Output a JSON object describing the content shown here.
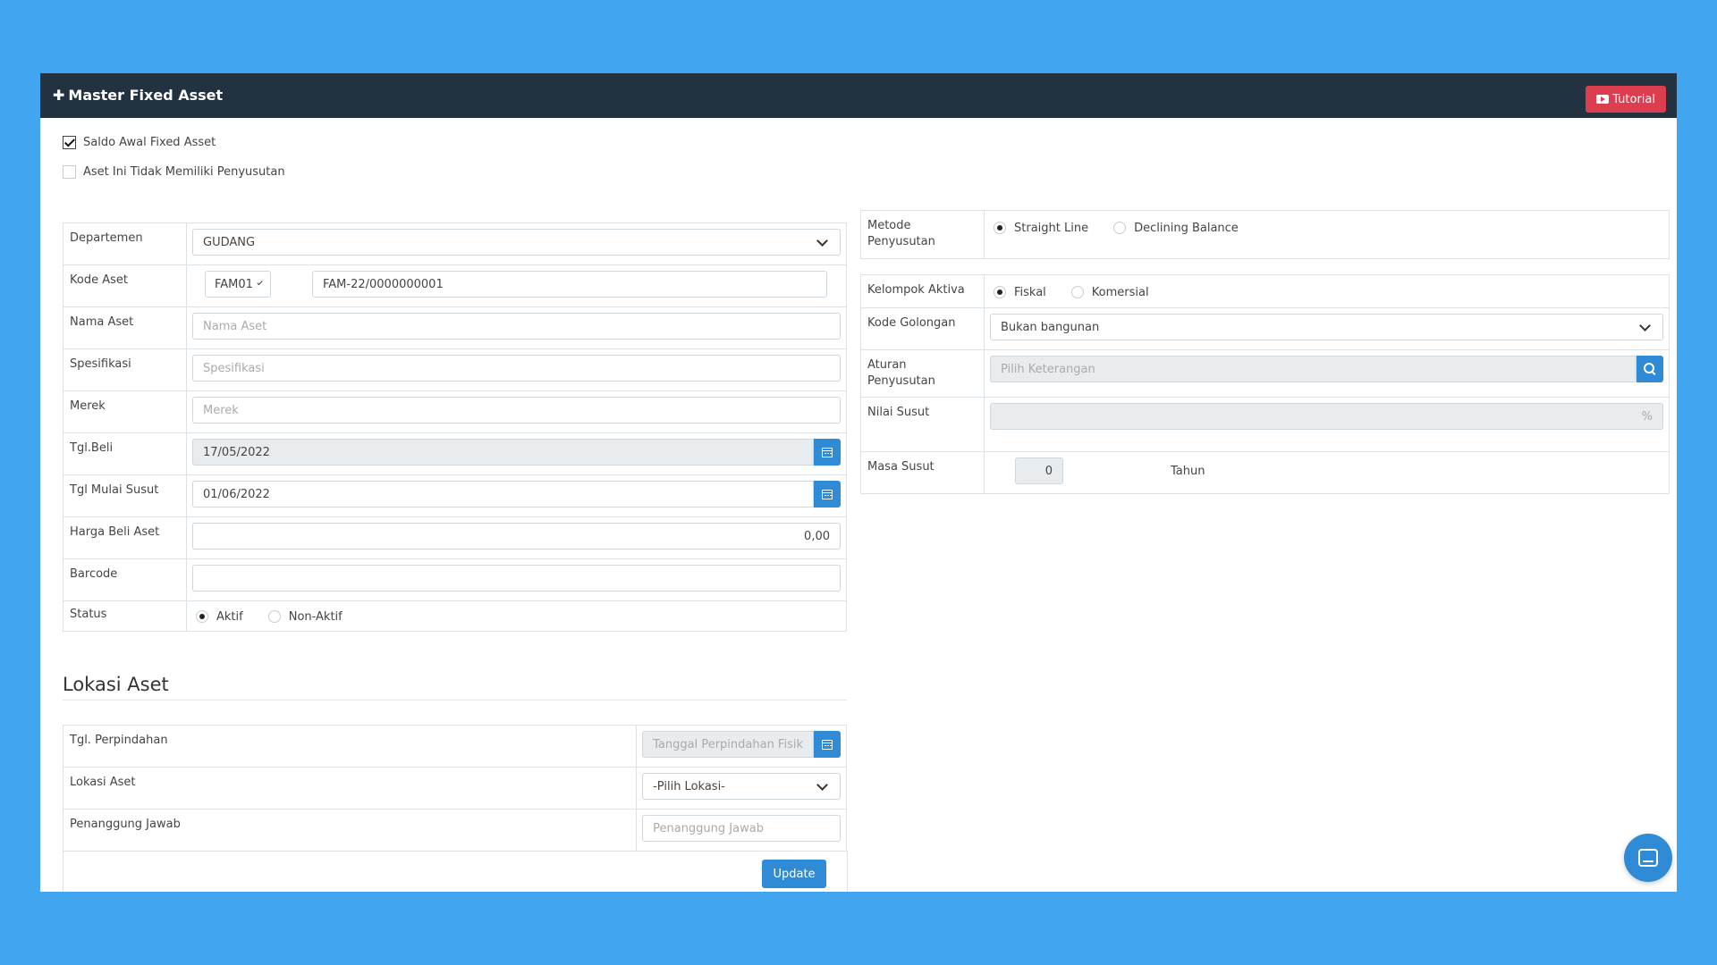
{
  "header": {
    "title": "Master Fixed Asset",
    "tutorial_label": "Tutorial"
  },
  "checkboxes": {
    "saldo_awal": {
      "label": "Saldo Awal Fixed Asset",
      "checked": true
    },
    "no_depreciation": {
      "label": "Aset Ini Tidak Memiliki Penyusutan",
      "checked": false
    }
  },
  "left_form": {
    "departemen": {
      "label": "Departemen",
      "value": "GUDANG"
    },
    "kode_aset": {
      "label": "Kode Aset",
      "prefix": "FAM01",
      "value": "FAM-22/0000000001"
    },
    "nama_aset": {
      "label": "Nama Aset",
      "placeholder": "Nama Aset"
    },
    "spesifikasi": {
      "label": "Spesifikasi",
      "placeholder": "Spesifikasi"
    },
    "merek": {
      "label": "Merek",
      "placeholder": "Merek"
    },
    "tgl_beli": {
      "label": "Tgl.Beli",
      "value": "17/05/2022"
    },
    "tgl_mulai_susut": {
      "label": "Tgl Mulai Susut",
      "value": "01/06/2022"
    },
    "harga_beli": {
      "label": "Harga Beli Aset",
      "value": "0,00"
    },
    "barcode": {
      "label": "Barcode",
      "value": ""
    },
    "status": {
      "label": "Status",
      "options": [
        "Aktif",
        "Non-Aktif"
      ],
      "selected": "Aktif"
    }
  },
  "right_form": {
    "metode": {
      "label": "Metode Penyusutan",
      "options": [
        "Straight Line",
        "Declining Balance"
      ],
      "selected": "Straight Line"
    },
    "kelompok": {
      "label": "Kelompok Aktiva",
      "options": [
        "Fiskal",
        "Komersial"
      ],
      "selected": "Fiskal"
    },
    "kode_golongan": {
      "label": "Kode Golongan",
      "value": "Bukan bangunan"
    },
    "aturan": {
      "label": "Aturan Penyusutan",
      "placeholder": "Pilih Keterangan"
    },
    "nilai_susut": {
      "label": "Nilai Susut",
      "unit": "%"
    },
    "masa_susut": {
      "label": "Masa Susut",
      "value": "0",
      "unit": "Tahun"
    }
  },
  "lokasi": {
    "title": "Lokasi Aset",
    "tgl_perpindahan": {
      "label": "Tgl. Perpindahan",
      "placeholder": "Tanggal Perpindahan Fisik"
    },
    "lokasi_aset": {
      "label": "Lokasi Aset",
      "value": "-Pilih Lokasi-"
    },
    "penanggung_jawab": {
      "label": "Penanggung Jawab",
      "placeholder": "Penanggung Jawab"
    },
    "update_label": "Update"
  },
  "colors": {
    "background": "#42a5f0",
    "header": "#233240",
    "accent": "#2f8bd6",
    "tutorial": "#dc3d4f"
  },
  "icons": [
    "calendar-icon",
    "search-icon",
    "youtube-icon",
    "chat-icon",
    "chevron-down-icon",
    "plus-icon"
  ]
}
